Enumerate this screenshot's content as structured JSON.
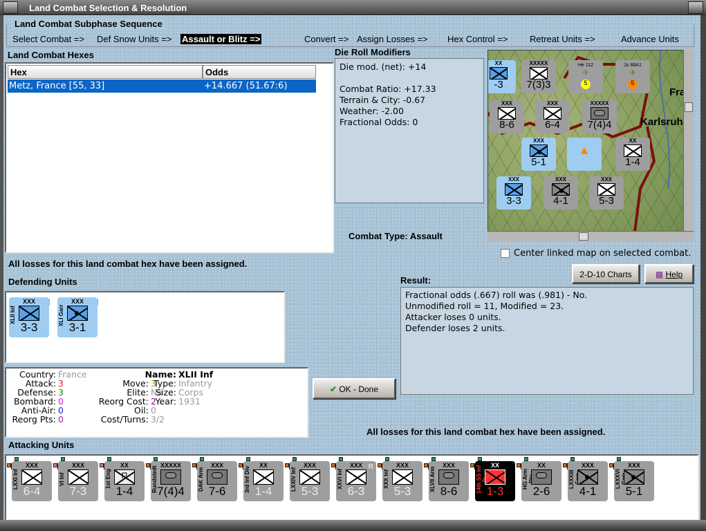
{
  "window": {
    "title": "Land Combat Selection & Resolution"
  },
  "subphase": {
    "title": "Land Combat Subphase Sequence",
    "steps": [
      "Select Combat =>",
      "Def Snow Units =>",
      "Assault or Blitz =>",
      "Convert =>",
      "Assign Losses =>",
      "Hex Control =>",
      "Retreat Units =>",
      "Advance Units"
    ],
    "active_index": 2
  },
  "hexes": {
    "title": "Land Combat Hexes",
    "columns": [
      "Hex",
      "Odds"
    ],
    "rows": [
      {
        "hex": "Metz, France [55, 33]",
        "odds": "+14.667 (51.67:6)"
      }
    ]
  },
  "die_roll": {
    "title": "Die Roll Modifiers",
    "lines": [
      "Die mod. (net): +14",
      "",
      "Combat Ratio: +17.33",
      "Terrain & City: -0.67",
      "Weather: -2.00",
      "Fractional Odds: 0"
    ]
  },
  "combat_type": {
    "label": "Combat Type:",
    "value": "Assault"
  },
  "map": {
    "labels": [
      "Karlsruh",
      "Fra"
    ],
    "center_checkbox": {
      "label": "Center linked map on selected combat.",
      "checked": false
    },
    "counters": [
      {
        "size": "XXXXX",
        "val": "7(3)3"
      },
      {
        "size": "XX",
        "val": "-3"
      },
      {
        "size": "XXX",
        "val": "8-6"
      },
      {
        "size": "XXX",
        "val": "6-4"
      },
      {
        "size": "XXXXX",
        "val": "7(4)4"
      },
      {
        "size": "XXX",
        "val": "5-1"
      },
      {
        "size": "XX",
        "val": "1-4"
      },
      {
        "size": "XXX",
        "val": "3-3"
      },
      {
        "size": "XXX",
        "val": "4-1"
      },
      {
        "size": "XXX",
        "val": "5-3"
      }
    ],
    "air": [
      {
        "name": "He 112",
        "val": "5"
      },
      {
        "name": "Ju 88A1",
        "val": "5"
      }
    ]
  },
  "losses_msg": "All losses for this land combat hex have been assigned.",
  "buttons": {
    "charts": "2-D-10 Charts",
    "help": "Help",
    "ok": "OK - Done"
  },
  "defending": {
    "title": "Defending Units",
    "units": [
      {
        "name": "XLII Inf",
        "size": "XXX",
        "val": "3-3",
        "status": "Destroyed",
        "type": "inf"
      },
      {
        "name": "XLI Garr",
        "size": "XXX",
        "val": "3-1",
        "status": "Destroyed",
        "type": "garr"
      }
    ]
  },
  "result": {
    "title": "Result:",
    "lines": [
      "Fractional odds (.667) roll was (.981)  - No.",
      "Unmodified roll = 11, Modified = 23.",
      "Attacker loses 0 units.",
      "Defender loses 2 units."
    ]
  },
  "info": {
    "country": {
      "k": "Country:",
      "v": "France"
    },
    "attack": {
      "k": "Attack:",
      "v": "3"
    },
    "defense": {
      "k": "Defense:",
      "v": "3"
    },
    "bombard": {
      "k": "Bombard:",
      "v": "0"
    },
    "antiair": {
      "k": "Anti-Air:",
      "v": "0"
    },
    "reorgpts": {
      "k": "Reorg Pts:",
      "v": "0"
    },
    "move": {
      "k": "Move:",
      "v": "3"
    },
    "elite": {
      "k": "Elite:",
      "v": "No"
    },
    "reorgcost": {
      "k": "Reorg Cost:",
      "v": "2"
    },
    "oil": {
      "k": "Oil:",
      "v": "0"
    },
    "costturns": {
      "k": "Cost/Turns:",
      "v": "3/2"
    },
    "name": {
      "k": "Name:",
      "v": "XLII Inf"
    },
    "type": {
      "k": "Type:",
      "v": "Infantry"
    },
    "size": {
      "k": "Size:",
      "v": "Corps"
    },
    "year": {
      "k": "Year:",
      "v": "1931"
    }
  },
  "colors": {
    "attack": "#e02020",
    "defense": "#208020",
    "bombard": "#e020e0",
    "antiair": "#2020d0",
    "reorgpts": "#a020a0",
    "move": "#a0a000",
    "reorgcost": "#a000a0",
    "muted": "#999999"
  },
  "attacking": {
    "title": "Attacking Units",
    "units": [
      {
        "name": "LXXI Inf",
        "size": "XXX",
        "val": "6-4",
        "status": "No effect",
        "sym": "x",
        "style": "grey"
      },
      {
        "name": "VI Inf",
        "size": "XXX",
        "val": "7-3",
        "status": "No effect",
        "sym": "x",
        "style": "grey"
      },
      {
        "name": "1st Eng",
        "size": "XX",
        "val": "1-4",
        "status": "No effect",
        "sym": "eng",
        "style": "grey"
      },
      {
        "name": "Rundstedt",
        "size": "XXXXX",
        "val": "7(4)4",
        "status": "No effect",
        "sym": "arm",
        "style": "grey"
      },
      {
        "name": "DAK Arm",
        "size": "XXX",
        "val": "7-6",
        "status": "No effect",
        "sym": "arm",
        "style": "grey"
      },
      {
        "name": "3rd Inf Div",
        "size": "XX",
        "val": "1-4",
        "status": "No effect",
        "sym": "x",
        "style": "grey"
      },
      {
        "name": "LXXIV Inf",
        "size": "XXX",
        "val": "5-3",
        "status": "No effect",
        "sym": "x",
        "style": "grey"
      },
      {
        "name": "XXVI Inf",
        "size": "XXX",
        "val": "6-3",
        "status": "No effect",
        "sym": "x",
        "style": "grey",
        "badge": "R"
      },
      {
        "name": "XXX Inf",
        "size": "XXX",
        "val": "5-3",
        "status": "No effect",
        "sym": "x",
        "style": "grey"
      },
      {
        "name": "XLVII Arm",
        "size": "XXX",
        "val": "8-6",
        "status": "No effect",
        "sym": "arm",
        "style": "grey"
      },
      {
        "name": "14th SS Inf D.",
        "size": "XX",
        "val": "1-3",
        "status": "No effect",
        "sym": "x",
        "style": "black"
      },
      {
        "name": "HG Arm Div",
        "size": "XX",
        "val": "2-6",
        "status": "No effect",
        "sym": "arm",
        "style": "grey"
      },
      {
        "name": "LXXXIII Garr",
        "size": "XXX",
        "val": "4-1",
        "status": "No effect",
        "sym": "garr",
        "style": "grey"
      },
      {
        "name": "LXXXVI Garr",
        "size": "XXX",
        "val": "5-1",
        "status": "No effect",
        "sym": "garr",
        "style": "grey"
      }
    ]
  }
}
